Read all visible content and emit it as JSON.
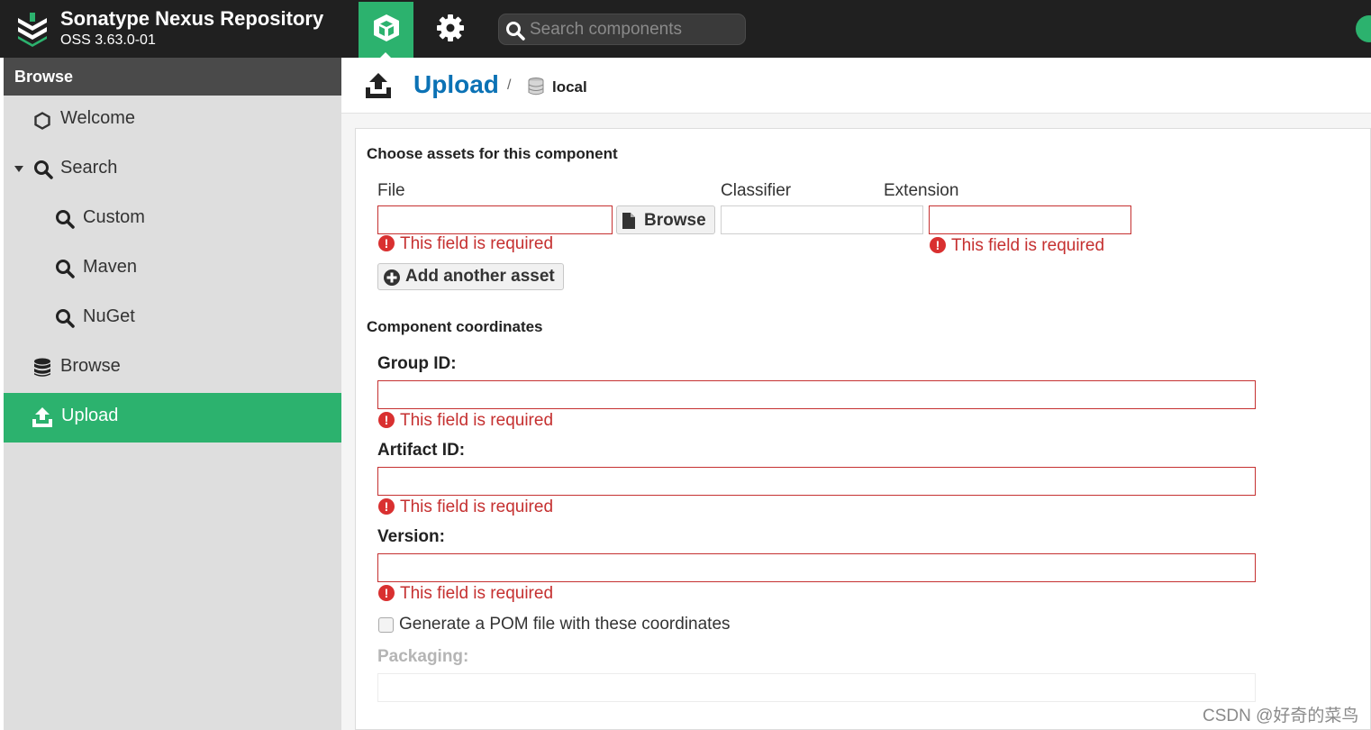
{
  "header": {
    "app_title": "Sonatype Nexus Repository",
    "version": "OSS 3.63.0-01",
    "search_placeholder": "Search components",
    "nav_browse_icon": "cube-icon",
    "nav_admin_icon": "gear-icon",
    "status": "check-circle-icon"
  },
  "colors": {
    "accent": "#2cb26e",
    "topbar": "#202020",
    "link": "#0b72b5",
    "error": "#c53030"
  },
  "sidebar": {
    "header": "Browse",
    "items": [
      {
        "label": "Welcome",
        "icon": "hexagon-icon"
      },
      {
        "label": "Search",
        "icon": "search-icon",
        "expanded": true
      },
      {
        "label": "Custom",
        "icon": "search-icon"
      },
      {
        "label": "Maven",
        "icon": "search-icon"
      },
      {
        "label": "NuGet",
        "icon": "search-icon"
      },
      {
        "label": "Browse",
        "icon": "database-icon"
      },
      {
        "label": "Upload",
        "icon": "upload-icon",
        "active": true
      }
    ]
  },
  "breadcrumb": {
    "title": "Upload",
    "separator": "/",
    "repository": "local"
  },
  "form": {
    "assets_title": "Choose assets for this component",
    "file_label": "File",
    "classifier_label": "Classifier",
    "extension_label": "Extension",
    "browse_button": "Browse",
    "add_asset_button": "Add another asset",
    "coordinates_title": "Component coordinates",
    "group_label": "Group ID:",
    "artifact_label": "Artifact ID:",
    "version_label": "Version:",
    "required_error": "This field is required",
    "generate_pom_label": "Generate a POM file with these coordinates",
    "generate_pom_checked": false,
    "packaging_label": "Packaging:"
  },
  "watermark": "CSDN @好奇的菜鸟"
}
